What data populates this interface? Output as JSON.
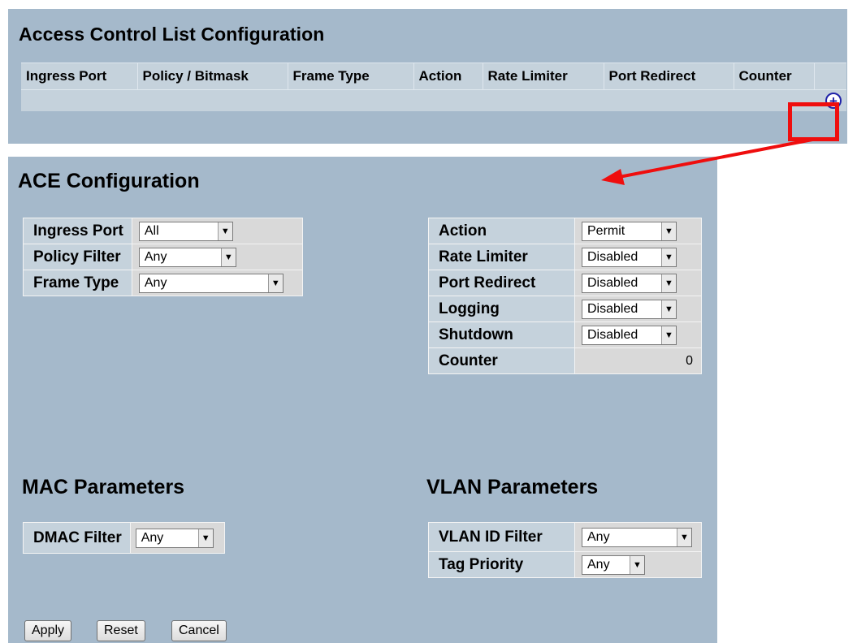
{
  "acl": {
    "title": "Access Control List Configuration",
    "columns": [
      "Ingress Port",
      "Policy / Bitmask",
      "Frame Type",
      "Action",
      "Rate Limiter",
      "Port Redirect",
      "Counter"
    ],
    "add_icon": "plus-circle-icon"
  },
  "ace": {
    "title": "ACE Configuration",
    "left": {
      "ingress_port": {
        "label": "Ingress Port",
        "value": "All"
      },
      "policy_filter": {
        "label": "Policy Filter",
        "value": "Any"
      },
      "frame_type": {
        "label": "Frame Type",
        "value": "Any"
      }
    },
    "right": {
      "action": {
        "label": "Action",
        "value": "Permit"
      },
      "rate_limiter": {
        "label": "Rate Limiter",
        "value": "Disabled"
      },
      "port_redirect": {
        "label": "Port Redirect",
        "value": "Disabled"
      },
      "logging": {
        "label": "Logging",
        "value": "Disabled"
      },
      "shutdown": {
        "label": "Shutdown",
        "value": "Disabled"
      },
      "counter": {
        "label": "Counter",
        "value": "0"
      }
    }
  },
  "mac": {
    "title": "MAC Parameters",
    "dmac_filter": {
      "label": "DMAC Filter",
      "value": "Any"
    }
  },
  "vlan": {
    "title": "VLAN Parameters",
    "vlan_id_filter": {
      "label": "VLAN ID Filter",
      "value": "Any"
    },
    "tag_priority": {
      "label": "Tag Priority",
      "value": "Any"
    }
  },
  "buttons": {
    "apply": "Apply",
    "reset": "Reset",
    "cancel": "Cancel"
  },
  "colors": {
    "panel": "#a5b9cb",
    "header": "#c5d2dc",
    "highlight": "#ef0e0e"
  }
}
